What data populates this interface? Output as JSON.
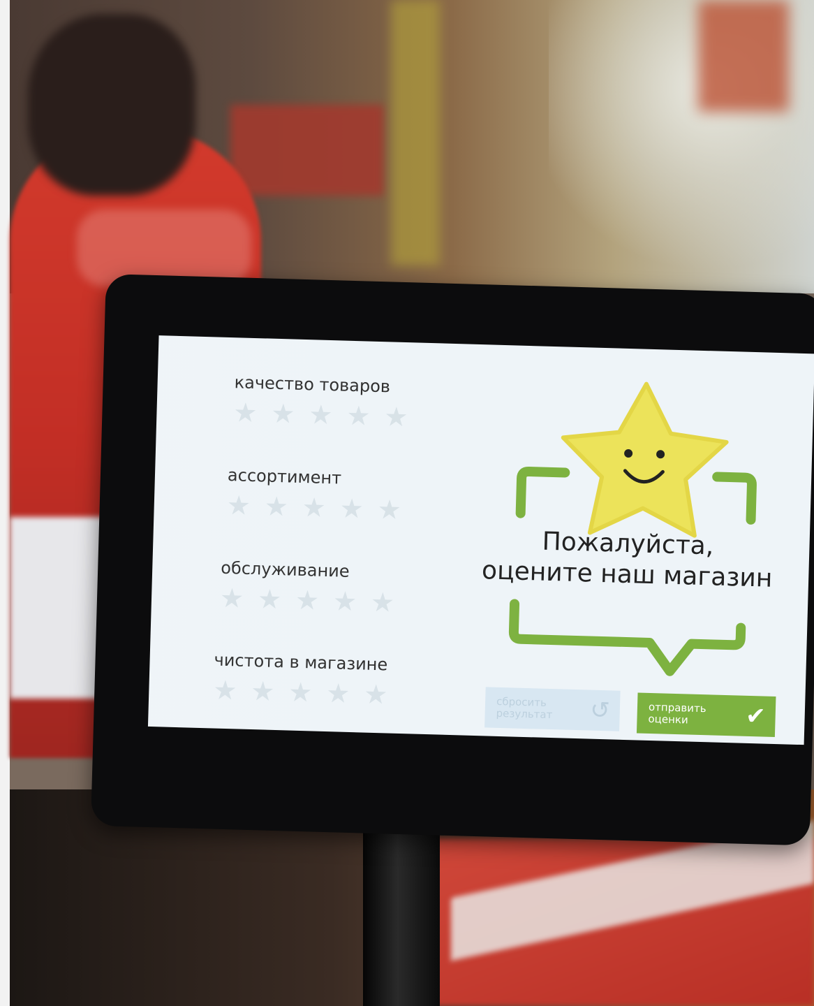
{
  "kiosk": {
    "criteria": [
      {
        "label": "качество товаров"
      },
      {
        "label": "ассортимент"
      },
      {
        "label": "обслуживание"
      },
      {
        "label": "чистота в магазине"
      }
    ],
    "headline_line1": "Пожалуйста,",
    "headline_line2": "оцените наш магазин",
    "reset_button": {
      "label": "сбросить результат",
      "icon": "undo-icon"
    },
    "submit_button": {
      "label": "отправить оценки",
      "icon": "check-icon"
    }
  },
  "colors": {
    "screen_bg": "#eef4f8",
    "accent_green": "#7db240",
    "star_yellow": "#ece35a",
    "reset_button_bg": "#d8e7f2"
  }
}
